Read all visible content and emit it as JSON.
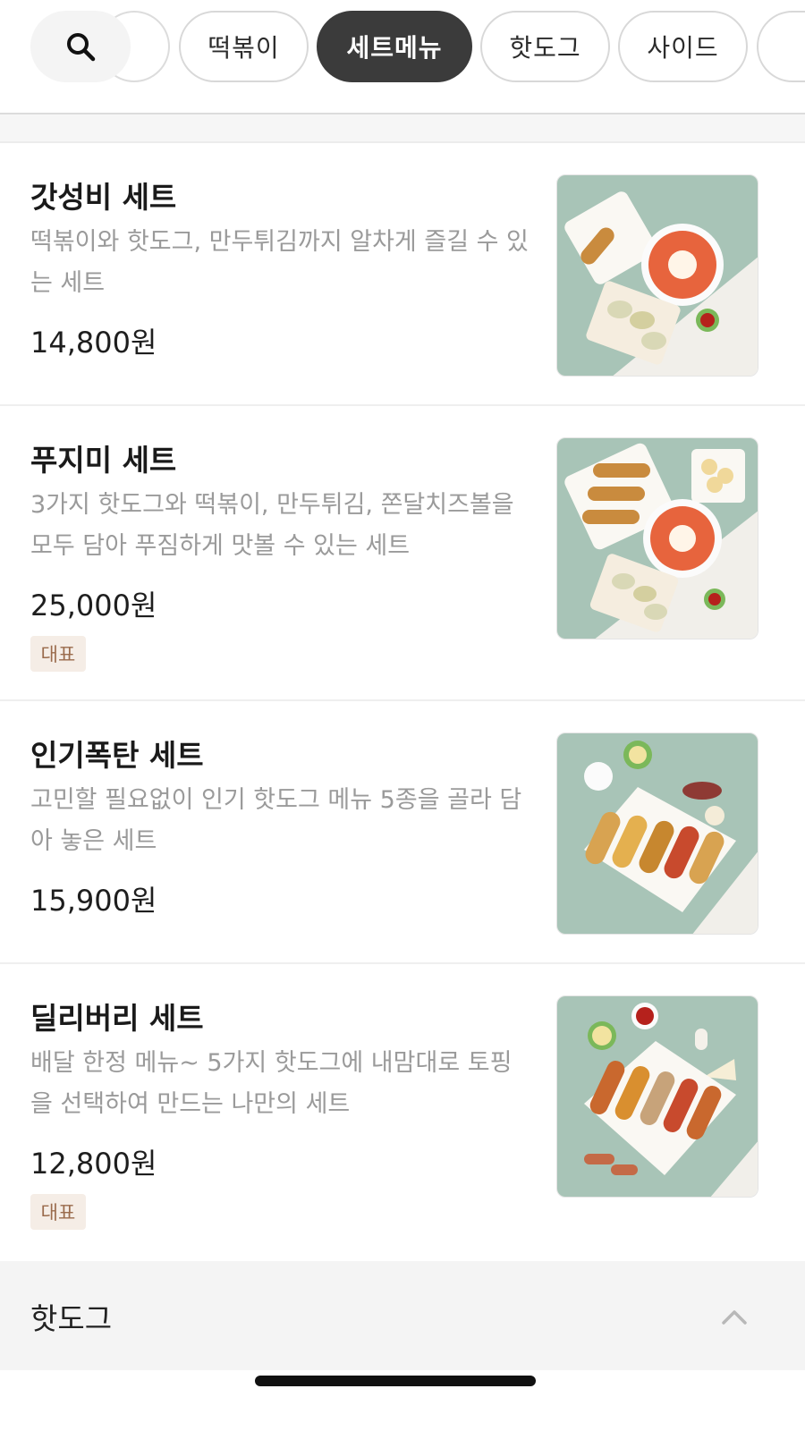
{
  "categories": {
    "search_icon": "search-icon",
    "tabs": [
      {
        "label": "떡볶이"
      },
      {
        "label": "세트메뉴",
        "active": true
      },
      {
        "label": "핫도그"
      },
      {
        "label": "사이드"
      }
    ]
  },
  "items": [
    {
      "name": "갓성비 세트",
      "desc": "떡볶이와 핫도그, 만두튀김까지 알차게 즐길 수 있는 세트",
      "price": "14,800원"
    },
    {
      "name": "푸지미 세트",
      "desc": "3가지 핫도그와 떡볶이, 만두튀김, 쫀달치즈볼을 모두 담아 푸짐하게 맛볼 수 있는 세트",
      "price": "25,000원",
      "badge": "대표"
    },
    {
      "name": "인기폭탄 세트",
      "desc": "고민할 필요없이 인기 핫도그 메뉴 5종을 골라 담아 놓은 세트",
      "price": "15,900원"
    },
    {
      "name": "딜리버리 세트",
      "desc": "배달 한정 메뉴~ 5가지 핫도그에 내맘대로 토핑을 선택하여 만드는 나만의 세트",
      "price": "12,800원",
      "badge": "대표"
    }
  ],
  "section": {
    "title": "핫도그",
    "chevron_icon": "chevron-up-icon"
  },
  "colors": {
    "active_tab": "#3b3b3b",
    "badge_bg": "#f5ede6",
    "badge_text": "#9a6b4c",
    "photo_bg": "#8fb5a6"
  }
}
